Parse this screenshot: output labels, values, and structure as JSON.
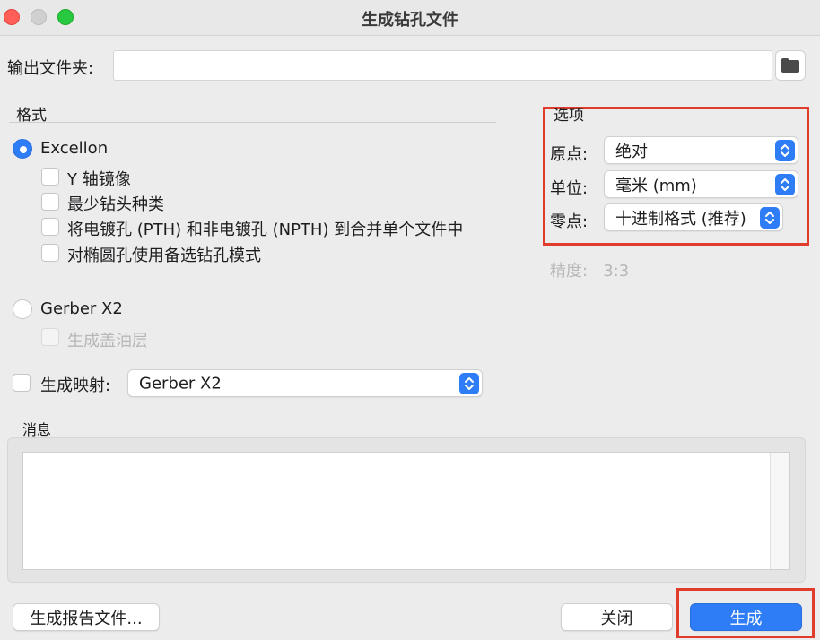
{
  "window": {
    "title": "生成钻孔文件"
  },
  "output": {
    "label": "输出文件夹:",
    "value": ""
  },
  "format": {
    "heading": "格式",
    "excellon": {
      "label": "Excellon",
      "selected": true,
      "options": [
        {
          "label": "Y 轴镜像",
          "checked": false
        },
        {
          "label": "最少钻头种类",
          "checked": false
        },
        {
          "label": "将电镀孔 (PTH) 和非电镀孔 (NPTH) 到合并单个文件中",
          "checked": false
        },
        {
          "label": "对椭圆孔使用备选钻孔模式",
          "checked": false
        }
      ]
    },
    "gerber": {
      "label": "Gerber X2",
      "selected": false,
      "option": {
        "label": "生成盖油层",
        "checked": false,
        "disabled": true
      }
    },
    "map": {
      "label": "生成映射:",
      "checked": false,
      "value": "Gerber X2"
    }
  },
  "options": {
    "heading": "选项",
    "origin": {
      "label": "原点:",
      "value": "绝对"
    },
    "units": {
      "label": "单位:",
      "value": "毫米 (mm)"
    },
    "zeros": {
      "label": "零点:",
      "value": "十进制格式 (推荐)"
    },
    "precision": "精度:   3:3"
  },
  "messages": {
    "heading": "消息",
    "content": ""
  },
  "buttons": {
    "report": "生成报告文件...",
    "close": "关闭",
    "generate": "生成"
  },
  "colors": {
    "accent": "#2f7df6",
    "highlight": "#e03c2c"
  }
}
